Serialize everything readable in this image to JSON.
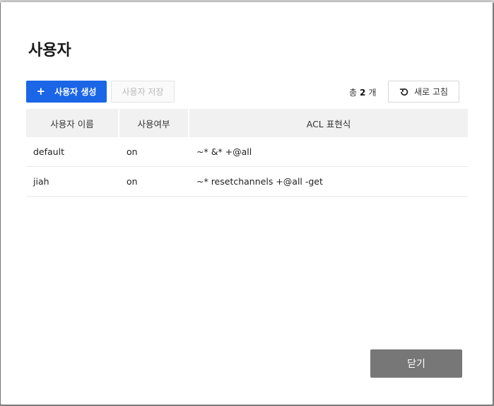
{
  "dialog": {
    "title": "사용자"
  },
  "toolbar": {
    "create_icon": "plus-icon",
    "create_label": "사용자 생성",
    "save_label": "사용자 저장",
    "total_prefix": "총",
    "total_count": "2",
    "total_suffix": "개",
    "refresh_icon": "refresh-icon",
    "refresh_label": "새로 고침"
  },
  "table": {
    "columns": [
      "사용자 이름",
      "사용여부",
      "ACL 표현식"
    ],
    "rows": [
      {
        "name": "default",
        "enabled": "on",
        "acl": "~* &* +@all"
      },
      {
        "name": "jiah",
        "enabled": "on",
        "acl": "~* resetchannels +@all -get"
      }
    ]
  },
  "footer": {
    "close_label": "닫기"
  },
  "colors": {
    "primary": "#1a66e6",
    "close_button": "#777777"
  }
}
